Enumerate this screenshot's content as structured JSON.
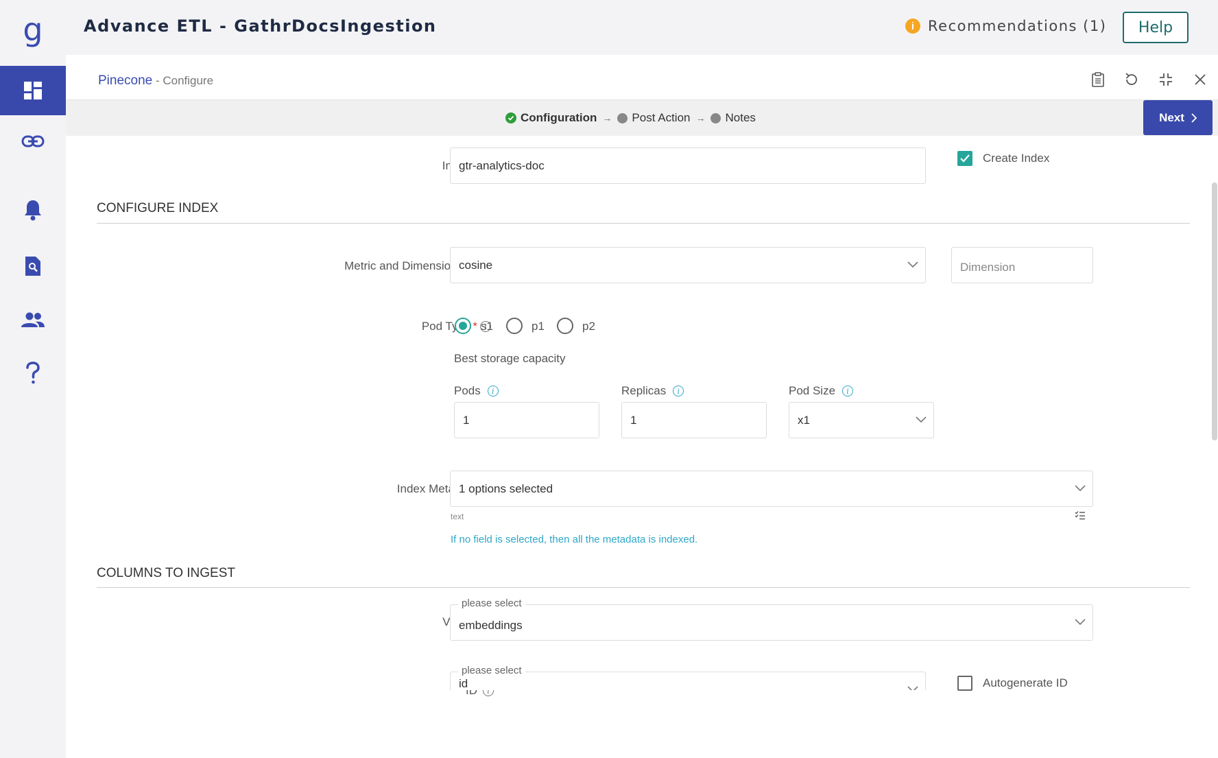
{
  "app": {
    "logo_glyph": "g",
    "title": "Advance ETL - GathrDocsIngestion",
    "recommendations_label": "Recommendations (1)",
    "recommendations_icon_glyph": "i",
    "help_label": "Help"
  },
  "sidebar": {
    "items": [
      {
        "name": "dashboard",
        "icon": "dashboard-icon",
        "active": true
      },
      {
        "name": "connections",
        "icon": "link-icon",
        "active": false
      },
      {
        "name": "notifications",
        "icon": "bell-icon",
        "active": false
      },
      {
        "name": "search",
        "icon": "search-document-icon",
        "active": false
      },
      {
        "name": "users",
        "icon": "people-icon",
        "active": false
      },
      {
        "name": "help",
        "icon": "question-icon",
        "active": false
      }
    ]
  },
  "panel": {
    "breadcrumb_main": "Pinecone",
    "breadcrumb_sub": " - Configure",
    "header_icons": [
      "clipboard-icon",
      "refresh-icon",
      "collapse-icon",
      "close-icon"
    ]
  },
  "steps": {
    "items": [
      {
        "label": "Configuration",
        "state": "done"
      },
      {
        "label": "Post Action",
        "state": "pending"
      },
      {
        "label": "Notes",
        "state": "pending"
      }
    ],
    "arrow": "→",
    "next_label": "Next"
  },
  "form": {
    "index": {
      "label": "Index",
      "required": "*",
      "value": "gtr-analytics-doc"
    },
    "create_index": {
      "label": "Create Index",
      "checked": true
    },
    "configure_section": "CONFIGURE INDEX",
    "metric": {
      "label": "Metric and Dimension(s)",
      "required": "*",
      "value": "cosine",
      "dimension_placeholder": "Dimension"
    },
    "pod_type": {
      "label": "Pod Type",
      "required": "*",
      "options": [
        {
          "label": "s1",
          "selected": true
        },
        {
          "label": "p1",
          "selected": false
        },
        {
          "label": "p2",
          "selected": false
        }
      ],
      "description": "Best storage capacity"
    },
    "pods": {
      "label": "Pods",
      "value": "1"
    },
    "replicas": {
      "label": "Replicas",
      "value": "1"
    },
    "pod_size": {
      "label": "Pod Size",
      "value": "x1"
    },
    "index_metadata": {
      "label": "Index Metadata",
      "value": "1 options selected",
      "caption": "text",
      "hint": "If no field is selected, then all the metadata is indexed."
    },
    "columns_section": "COLUMNS TO INGEST",
    "values": {
      "label": "Values",
      "float_label": "please select",
      "value": "embeddings"
    },
    "id": {
      "label": "ID",
      "float_label": "please select",
      "value": "id"
    },
    "autogenerate_id": {
      "label": "Autogenerate ID",
      "checked": false
    }
  }
}
